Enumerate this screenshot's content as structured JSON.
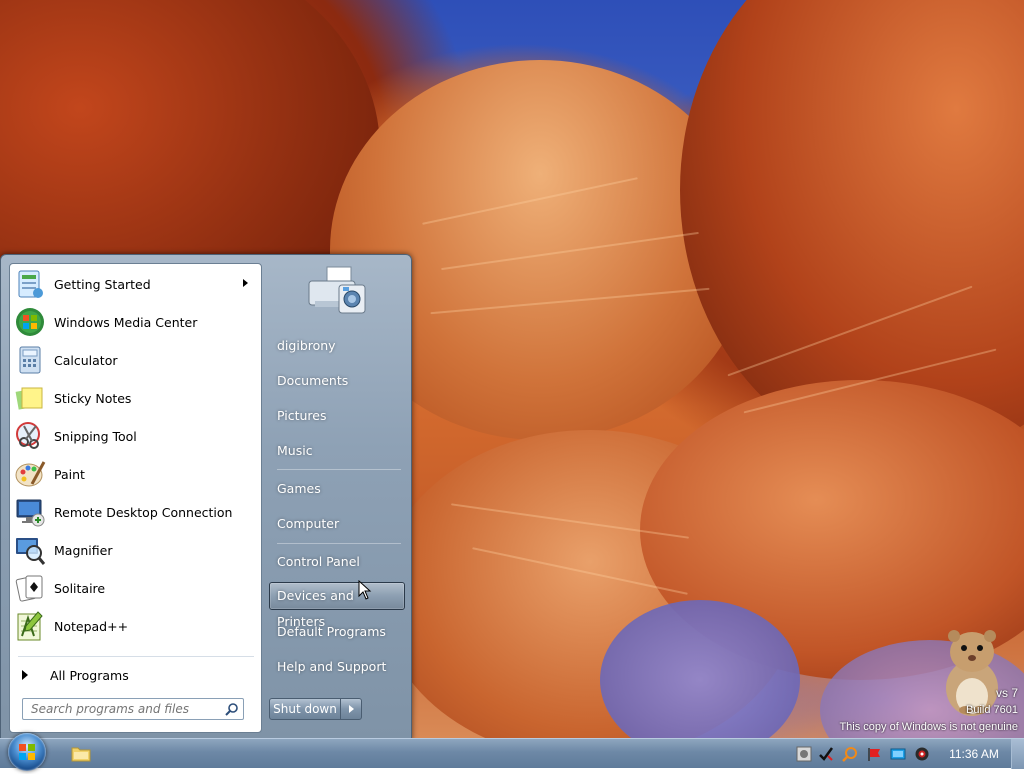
{
  "start_menu": {
    "programs": [
      {
        "label": "Getting Started",
        "icon": "getting-started-icon",
        "has_submenu": true
      },
      {
        "label": "Windows Media Center",
        "icon": "windows-media-center-icon",
        "has_submenu": false
      },
      {
        "label": "Calculator",
        "icon": "calculator-icon",
        "has_submenu": false
      },
      {
        "label": "Sticky Notes",
        "icon": "sticky-notes-icon",
        "has_submenu": false
      },
      {
        "label": "Snipping Tool",
        "icon": "snipping-tool-icon",
        "has_submenu": false
      },
      {
        "label": "Paint",
        "icon": "paint-icon",
        "has_submenu": false
      },
      {
        "label": "Remote Desktop Connection",
        "icon": "remote-desktop-icon",
        "has_submenu": false
      },
      {
        "label": "Magnifier",
        "icon": "magnifier-icon",
        "has_submenu": false
      },
      {
        "label": "Solitaire",
        "icon": "solitaire-icon",
        "has_submenu": false
      },
      {
        "label": "Notepad++",
        "icon": "notepad-plus-plus-icon",
        "has_submenu": false
      }
    ],
    "all_programs_label": "All Programs",
    "search_placeholder": "Search programs and files",
    "places": [
      {
        "label": "digibrony"
      },
      {
        "label": "Documents"
      },
      {
        "label": "Pictures"
      },
      {
        "label": "Music"
      },
      {
        "label": "Games"
      },
      {
        "label": "Computer"
      },
      {
        "label": "Control Panel"
      },
      {
        "label": "Devices and Printers",
        "hovered": true
      },
      {
        "label": "Default Programs"
      },
      {
        "label": "Help and Support"
      }
    ],
    "shutdown_label": "Shut down"
  },
  "watermark": {
    "line1": "vs 7",
    "line2": "Build 7601",
    "line3": "This copy of Windows is not genuine"
  },
  "taskbar": {
    "clock": "11:36 AM"
  },
  "colors": {
    "menu_frame": "#8ea1b5",
    "taskbar": "#6d88a6",
    "sky": "#2e4fb8",
    "rock": "#c8602a"
  }
}
